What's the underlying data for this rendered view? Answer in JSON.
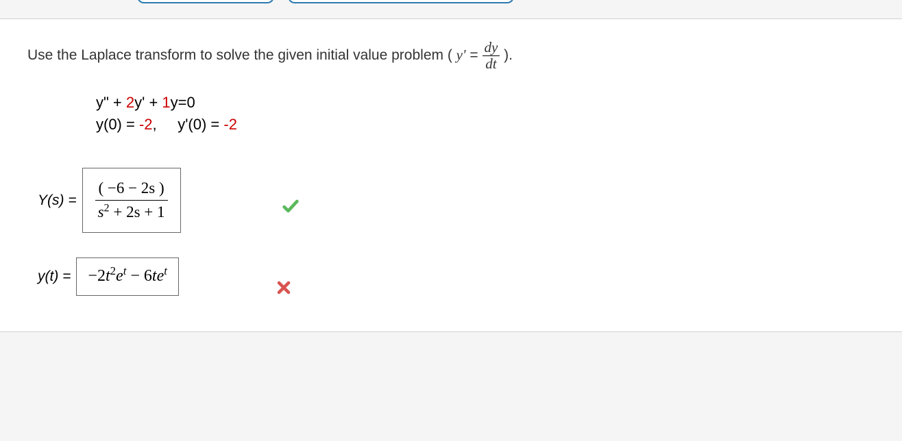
{
  "instruction": {
    "prefix": "Use the Laplace transform to solve the given initial value problem ( ",
    "var": "y′",
    "equals": " = ",
    "frac_num": "dy",
    "frac_den": "dt",
    "suffix": " )."
  },
  "problem": {
    "ode_prefix": "y\" + ",
    "ode_coeff1": "2",
    "ode_mid1": "y' + ",
    "ode_coeff2": "1",
    "ode_suffix": "y=0",
    "ic_prefix": "y(0) = ",
    "ic_val1": "-2",
    "ic_sep": ",     y'(0) = ",
    "ic_val2": "-2"
  },
  "answer1": {
    "label": "Y(s) = ",
    "numerator": "( −6 − 2s )",
    "denom_s": "s",
    "denom_exp": "2",
    "denom_rest": " + 2s + 1",
    "feedback": "correct"
  },
  "answer2": {
    "label": "y(t) = ",
    "expr_part1": "−2",
    "expr_t": "t",
    "expr_exp1": "2",
    "expr_e1": "e",
    "expr_eexp1": "t",
    "expr_mid": " − 6",
    "expr_t2": "t",
    "expr_e2": "e",
    "expr_eexp2": "t",
    "feedback": "incorrect"
  }
}
